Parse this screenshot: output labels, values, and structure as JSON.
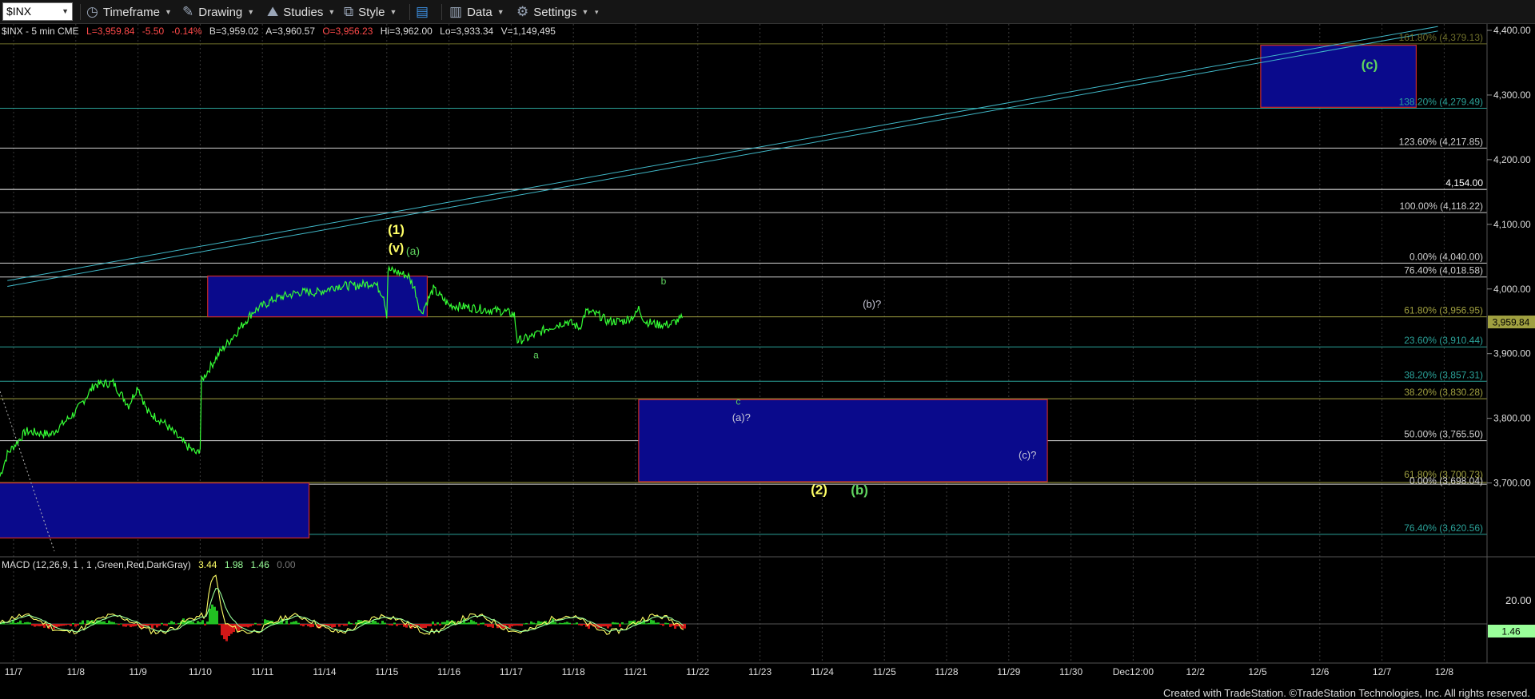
{
  "toolbar": {
    "symbol": "$INX",
    "timeframe": "Timeframe",
    "drawing": "Drawing",
    "studies": "Studies",
    "style": "Style",
    "data": "Data",
    "settings": "Settings"
  },
  "header": {
    "symbol_desc": "$INX - 5 min  CME",
    "last": "L=3,959.84",
    "change": "-5.50",
    "change_pct": "-0.14%",
    "bid": "B=3,959.02",
    "ask": "A=3,960.57",
    "open": "O=3,956.23",
    "high": "Hi=3,962.00",
    "low": "Lo=3,933.34",
    "volume": "V=1,149,495"
  },
  "price_axis": {
    "ticks": [
      "4,400.00",
      "4,300.00",
      "4,200.00",
      "4,100.00",
      "4,000.00",
      "3,900.00",
      "3,800.00",
      "3,700.00"
    ],
    "ylim": [
      3615,
      4415
    ],
    "current_price": "3,959.84"
  },
  "fib_levels": [
    {
      "label": "161.80% (4,379.13)",
      "value": 4379.13,
      "color": "#6f6f2a"
    },
    {
      "label": "138.20% (4,279.49)",
      "value": 4279.49,
      "color": "#2aa198"
    },
    {
      "label": "123.60% (4,217.85)",
      "value": 4217.85,
      "color": "#d0d0d0"
    },
    {
      "label": "4,154.00",
      "value": 4154.0,
      "color": "#ffffff"
    },
    {
      "label": "100.00% (4,118.22)",
      "value": 4118.22,
      "color": "#d0d0d0"
    },
    {
      "label": "0.00% (4,040.00)",
      "value": 4040.0,
      "color": "#d0d0d0"
    },
    {
      "label": "76.40% (4,018.58)",
      "value": 4018.58,
      "color": "#d0d0d0"
    },
    {
      "label": "61.80% (3,956.95)",
      "value": 3956.95,
      "color": "#a0a040"
    },
    {
      "label": "23.60% (3,910.44)",
      "value": 3910.44,
      "color": "#2aa198"
    },
    {
      "label": "38.20% (3,857.31)",
      "value": 3857.31,
      "color": "#2aa198"
    },
    {
      "label": "38.20% (3,830.28)",
      "value": 3830.28,
      "color": "#a0a040"
    },
    {
      "label": "50.00% (3,765.50)",
      "value": 3765.5,
      "color": "#d0d0d0"
    },
    {
      "label": "61.80% (3,700.73)",
      "value": 3700.73,
      "color": "#a0a040"
    },
    {
      "label": "0.00% (3,698.04)",
      "value": 3698.04,
      "color": "#d0d0d0"
    },
    {
      "label": "76.40% (3,620.56)",
      "value": 3620.56,
      "color": "#2aa198"
    }
  ],
  "x_axis": {
    "labels": [
      "11/7",
      "11/8",
      "11/9",
      "11/10",
      "11/11",
      "11/14",
      "11/15",
      "11/16",
      "11/17",
      "11/18",
      "11/21",
      "11/22",
      "11/23",
      "11/24",
      "11/25",
      "11/28",
      "11/29",
      "11/30",
      "Dec12:00",
      "12/2",
      "12/5",
      "12/6",
      "12/7",
      "12/8"
    ]
  },
  "annotations": [
    {
      "text": "(1)",
      "color": "#ffff66",
      "price": 4085,
      "day": 6.15,
      "size": 17
    },
    {
      "text": "(v)",
      "color": "#ffff66",
      "price": 4057,
      "day": 6.15,
      "size": 16
    },
    {
      "text": "(a)",
      "color": "#5fd35f",
      "price": 4053,
      "day": 6.42,
      "size": 14
    },
    {
      "text": "b",
      "color": "#5fd35f",
      "price": 4007,
      "day": 10.45,
      "size": 12
    },
    {
      "text": "(b)?",
      "color": "#c8c8d8",
      "price": 3971,
      "day": 13.8,
      "size": 13
    },
    {
      "text": "a",
      "color": "#5fd35f",
      "price": 3893,
      "day": 8.4,
      "size": 12
    },
    {
      "text": "c",
      "color": "#5fd35f",
      "price": 3821,
      "day": 11.65,
      "size": 12
    },
    {
      "text": "(a)?",
      "color": "#c8c8d8",
      "price": 3796,
      "day": 11.7,
      "size": 13
    },
    {
      "text": "(c)?",
      "color": "#c8c8d8",
      "price": 3738,
      "day": 16.3,
      "size": 13
    },
    {
      "text": "(2)",
      "color": "#ffff66",
      "price": 3683,
      "day": 12.95,
      "size": 17
    },
    {
      "text": "(b)",
      "color": "#5fd35f",
      "price": 3682,
      "day": 13.6,
      "size": 17
    },
    {
      "text": "(c)",
      "color": "#5fd35f",
      "price": 4340,
      "day": 21.8,
      "size": 17
    }
  ],
  "boxes": [
    {
      "name": "target-box-1",
      "d0": 3.12,
      "d1": 6.65,
      "p0": 3957,
      "p1": 4020
    },
    {
      "name": "target-box-2",
      "d0": 10.05,
      "d1": 16.62,
      "p0": 3702,
      "p1": 3829
    },
    {
      "name": "target-box-3",
      "d0": -0.5,
      "d1": 4.75,
      "p0": 3615,
      "p1": 3700
    },
    {
      "name": "target-box-4",
      "d0": 20.05,
      "d1": 22.55,
      "p0": 4281,
      "p1": 4377
    }
  ],
  "trend_lines": [
    {
      "d0": -0.1,
      "p0": 4004,
      "d1": 22.9,
      "p1": 4399
    },
    {
      "d0": -0.1,
      "p0": 4013,
      "d1": 22.9,
      "p1": 4406
    }
  ],
  "macd": {
    "label": "MACD (12,26,9, 1 , 1 ,Green,Red,DarkGray)",
    "v1": "3.44",
    "v2": "1.98",
    "v3": "1.46",
    "v4": "0.00",
    "axis_tick": "20.00",
    "current_value": "1.46"
  },
  "footer": "Created with TradeStation. ©TradeStation Technologies, Inc. All rights reserved."
}
